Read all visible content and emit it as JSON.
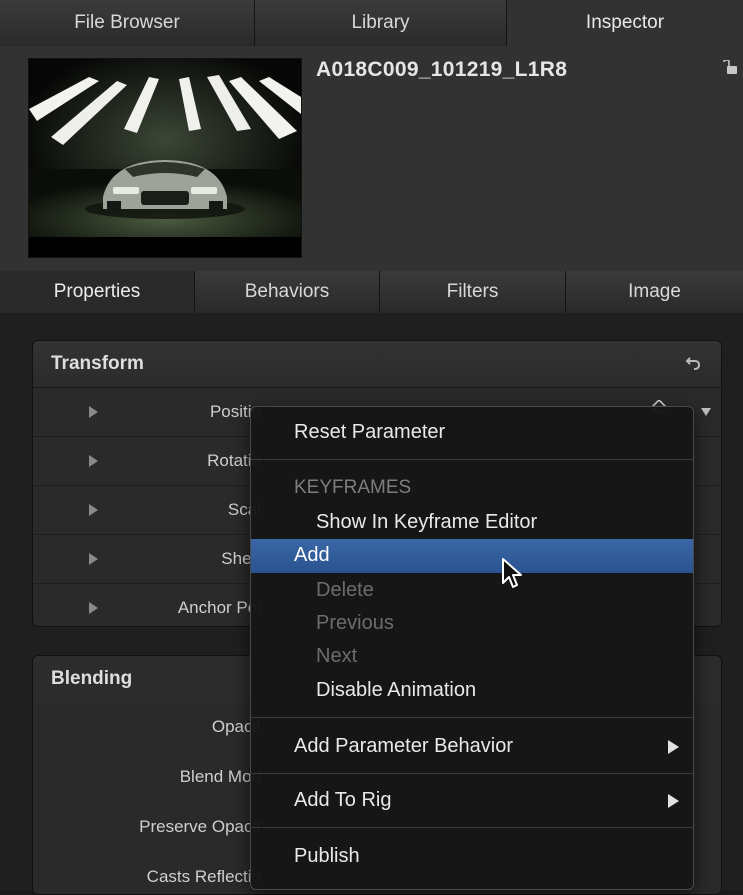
{
  "top_tabs": [
    {
      "label": "File Browser",
      "active": false
    },
    {
      "label": "Library",
      "active": false
    },
    {
      "label": "Inspector",
      "active": true
    }
  ],
  "header": {
    "clip_name": "A018C009_101219_L1R8",
    "lock_icon": "lock-open-icon",
    "thumbnail": "car-in-studio-image"
  },
  "sub_tabs": [
    {
      "label": "Properties",
      "active": true
    },
    {
      "label": "Behaviors",
      "active": false
    },
    {
      "label": "Filters",
      "active": false
    },
    {
      "label": "Image",
      "active": false
    }
  ],
  "transform": {
    "title": "Transform",
    "reset_icon": "reset-arrow-icon",
    "rows": [
      "Positio",
      "Rotatio",
      "Scal",
      "Shea",
      "Anchor Poi"
    ]
  },
  "blending": {
    "title": "Blending",
    "rows": [
      "Opacit",
      "Blend Mod",
      "Preserve Opacit",
      "Casts Reflectio"
    ]
  },
  "context_menu": {
    "reset_parameter": "Reset Parameter",
    "keyframes_header": "KEYFRAMES",
    "show_in_keyframe_editor": "Show In Keyframe Editor",
    "add": "Add",
    "delete": "Delete",
    "previous": "Previous",
    "next": "Next",
    "disable_animation": "Disable Animation",
    "add_parameter_behavior": "Add Parameter Behavior",
    "add_to_rig": "Add To Rig",
    "publish": "Publish",
    "highlighted_item": "Add"
  },
  "colors": {
    "highlight": "#2f5c9c",
    "panel": "#2a2a2a",
    "menu_bg": "#161616"
  }
}
